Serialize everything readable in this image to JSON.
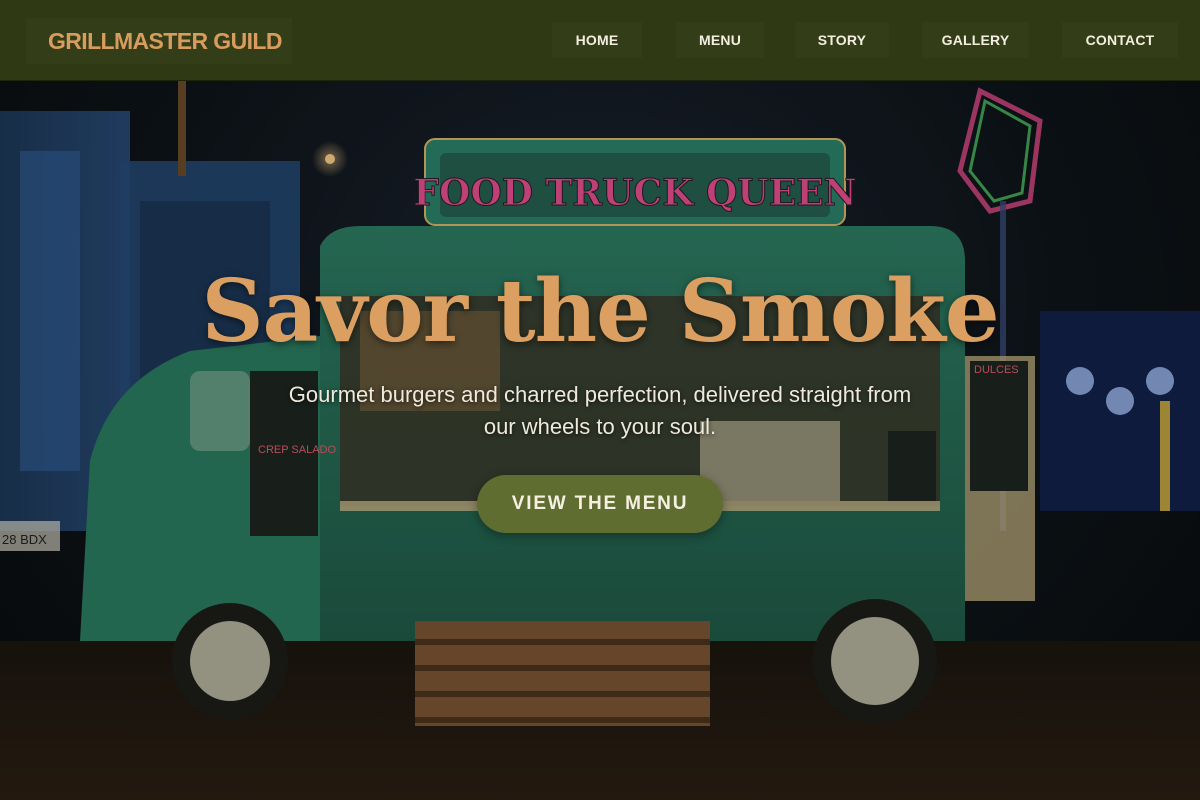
{
  "brand": {
    "name": "GRILLMASTER GUILD"
  },
  "nav": {
    "items": [
      {
        "label": "HOME"
      },
      {
        "label": "MENU"
      },
      {
        "label": "STORY"
      },
      {
        "label": "GALLERY"
      },
      {
        "label": "CONTACT"
      }
    ]
  },
  "hero": {
    "title": "Savor the Smoke",
    "subtitle": "Gourmet burgers and charred perfection, delivered straight from our wheels to your soul.",
    "cta_label": "VIEW THE MENU",
    "background": {
      "truck_sign": "FOOD TRUCK QUEEN",
      "plate": "28 BDX",
      "menu_board": "CREP SALADO",
      "menu_board_right": "DULCES"
    }
  },
  "colors": {
    "nav_bg": "#2f3a15",
    "brand_accent": "#d89c5e",
    "title_color": "#dba061",
    "cta_bg": "#5f6d31",
    "truck_green": "#2f7c63"
  }
}
